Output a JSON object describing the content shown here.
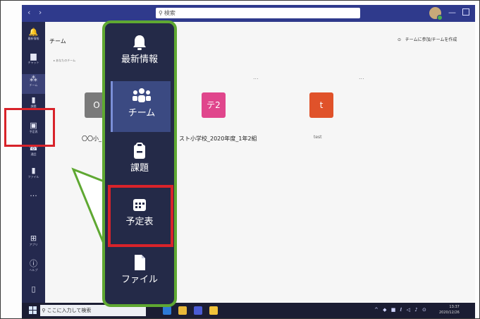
{
  "titlebar": {
    "nav": "‹ ›",
    "search_placeholder": "検索",
    "minimize": "—"
  },
  "rail": {
    "items": [
      {
        "label": "最新情報",
        "icon": "bell-icon",
        "glyph": "🔔"
      },
      {
        "label": "チャット",
        "icon": "chat-icon",
        "glyph": "▆"
      },
      {
        "label": "チーム",
        "icon": "teams-icon",
        "glyph": "⁂"
      },
      {
        "label": "課題",
        "icon": "assignment-icon",
        "glyph": "▮"
      },
      {
        "label": "予定表",
        "icon": "calendar-icon",
        "glyph": "▣"
      },
      {
        "label": "通話",
        "icon": "phone-icon",
        "glyph": "☎"
      },
      {
        "label": "ファイル",
        "icon": "file-icon",
        "glyph": "▮"
      },
      {
        "label": "...",
        "icon": "more-icon",
        "glyph": "···"
      },
      {
        "label": "アプリ",
        "icon": "apps-icon",
        "glyph": "⊞"
      },
      {
        "label": "ヘルプ",
        "icon": "help-icon",
        "glyph": "ⓘ"
      },
      {
        "label": "",
        "icon": "device-icon",
        "glyph": "▯"
      }
    ]
  },
  "content": {
    "title": "チーム",
    "section": "▸ あなたのチーム",
    "join_create": "チームに参加/チームを作成",
    "ellipsis": "...",
    "teams": [
      {
        "tile_text": "O",
        "name": "〇〇小_",
        "color": "#7a7a7a"
      },
      {
        "tile_text": "テ2",
        "name": "スト小学校_2020年度_1年2組",
        "color": "#e0468c"
      },
      {
        "tile_text": "t",
        "name": "test",
        "color": "#e0522a"
      }
    ]
  },
  "popup": {
    "items": [
      {
        "label": "最新情報",
        "icon": "bell-icon"
      },
      {
        "label": "チーム",
        "icon": "teams-icon"
      },
      {
        "label": "課題",
        "icon": "assignment-icon"
      },
      {
        "label": "予定表",
        "icon": "calendar-icon"
      },
      {
        "label": "ファイル",
        "icon": "file-icon"
      }
    ],
    "active": "チーム",
    "highlighted": "予定表"
  },
  "taskbar": {
    "search_text": "ここに入力して検索",
    "tray": "^ ◆ ■ ℓ ◁ ♪ ⊙",
    "time": "13:37",
    "date": "2020/12/26"
  },
  "colors": {
    "titlebar": "#2f3a8c",
    "rail": "#24294e",
    "popup_border": "#5fa832",
    "highlight": "#d8232a"
  }
}
